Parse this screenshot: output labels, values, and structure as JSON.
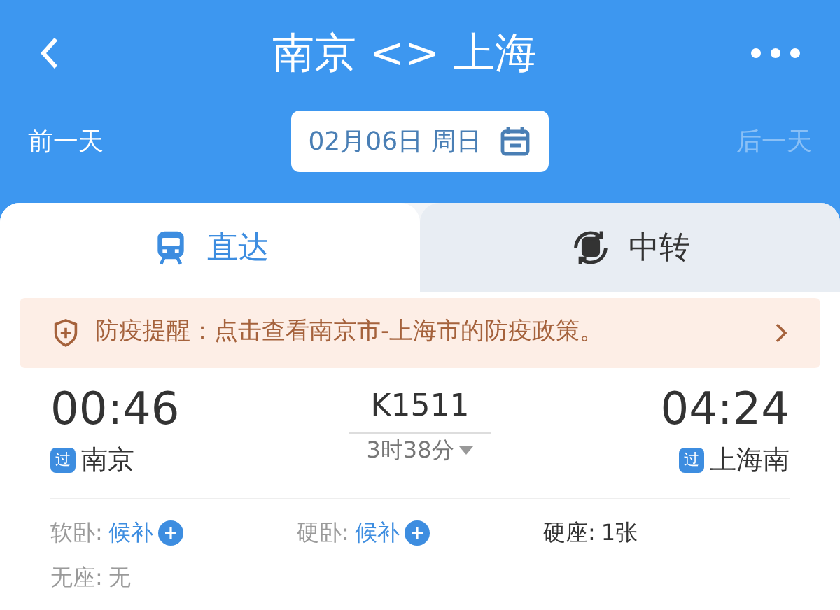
{
  "header": {
    "title": "南京 <> 上海"
  },
  "date_nav": {
    "prev": {
      "label": "前一天",
      "disabled": false
    },
    "date": "02月06日 周日",
    "next": {
      "label": "后一天",
      "disabled": true
    }
  },
  "tabs": [
    {
      "label": "直达",
      "kind": "direct",
      "selected": true
    },
    {
      "label": "中转",
      "kind": "transfer",
      "selected": false
    }
  ],
  "notice": {
    "text": "防疫提醒：点击查看南京市-上海市的防疫政策。"
  },
  "train": {
    "number": "K1511",
    "duration": "3时38分",
    "depart": {
      "time": "00:46",
      "badge": "过",
      "station": "南京"
    },
    "arrive": {
      "time": "04:24",
      "badge": "过",
      "station": "上海南"
    },
    "seats": [
      {
        "kind": "waitlist",
        "label": "软卧:",
        "value": "候补"
      },
      {
        "kind": "waitlist",
        "label": "硬卧:",
        "value": "候补"
      },
      {
        "kind": "count",
        "label": "硬座:",
        "value": "1张"
      },
      {
        "kind": "none",
        "label": "无座:",
        "value": "无"
      }
    ]
  }
}
